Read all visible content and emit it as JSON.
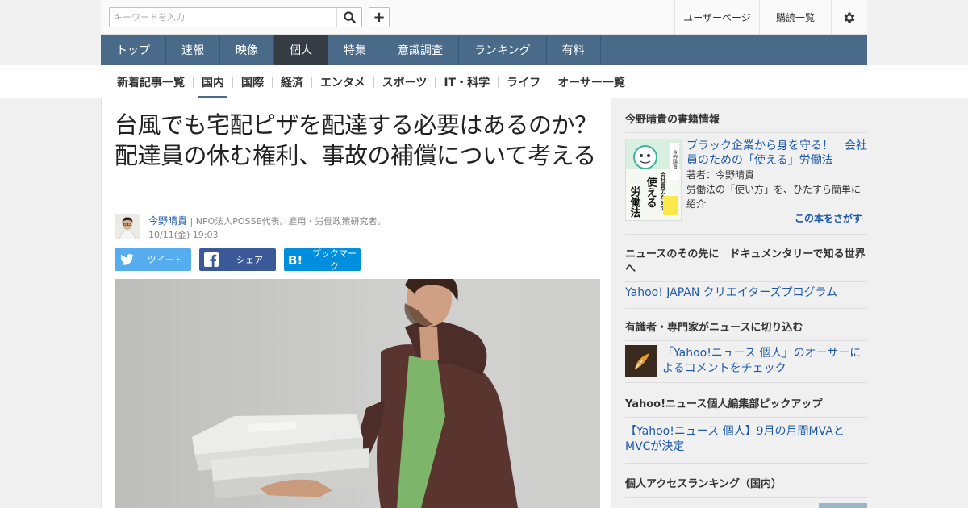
{
  "search": {
    "placeholder": "キーワードを入力"
  },
  "header": {
    "links": [
      "ユーザーページ",
      "購読一覧"
    ]
  },
  "nav": {
    "items": [
      "トップ",
      "速報",
      "映像",
      "個人",
      "特集",
      "意識調査",
      "ランキング",
      "有料"
    ],
    "active": "個人"
  },
  "subnav": {
    "items": [
      "新着記事一覧",
      "国内",
      "国際",
      "経済",
      "エンタメ",
      "スポーツ",
      "IT・科学",
      "ライフ",
      "オーサー一覧"
    ],
    "active": "国内"
  },
  "article": {
    "title": "台風でも宅配ピザを配達する必要はあるのか？　配達員の休む権利、事故の補償について考える",
    "author": "今野晴貴",
    "author_desc": "| NPO法人POSSE代表。雇用・労働政策研究者。",
    "date": "10/11(金) 19:03"
  },
  "share": {
    "tweet": "ツイート",
    "fb": "シェア",
    "hatena": "ブックマーク"
  },
  "sidebar": {
    "book_heading": "今野晴貴の書籍情報",
    "book_title": "ブラック企業から身を守る！　会社員のための「使える」労働法",
    "book_author": "著者：今野晴貴",
    "book_desc": "労働法の「使い方」を、ひたすら簡単に紹介",
    "book_search": "この本をさがす",
    "book_cover": {
      "top": "会社員のための",
      "main": "使える",
      "bottom": "労働法",
      "band": "今野晴貴"
    },
    "doc_heading": "ニュースのその先に　ドキュメンタリーで知る世界へ",
    "doc_link": "Yahoo! JAPAN クリエイターズプログラム",
    "expert_heading": "有識者・専門家がニュースに切り込む",
    "expert_link": "「Yahoo!ニュース 個人」のオーサーによるコメントをチェック",
    "pickup_heading": "Yahoo!ニュース個人編集部ピックアップ",
    "pickup_link": "【Yahoo!ニュース 個人】9月の月間MVAとMVCが決定",
    "ranking_heading": "個人アクセスランキング（国内）"
  },
  "colors": {
    "nav": "#496a89",
    "nav_active": "#363c44",
    "twitter": "#55acee",
    "facebook": "#3b5998",
    "hatena": "#008fde",
    "link": "#1e5aa8"
  }
}
